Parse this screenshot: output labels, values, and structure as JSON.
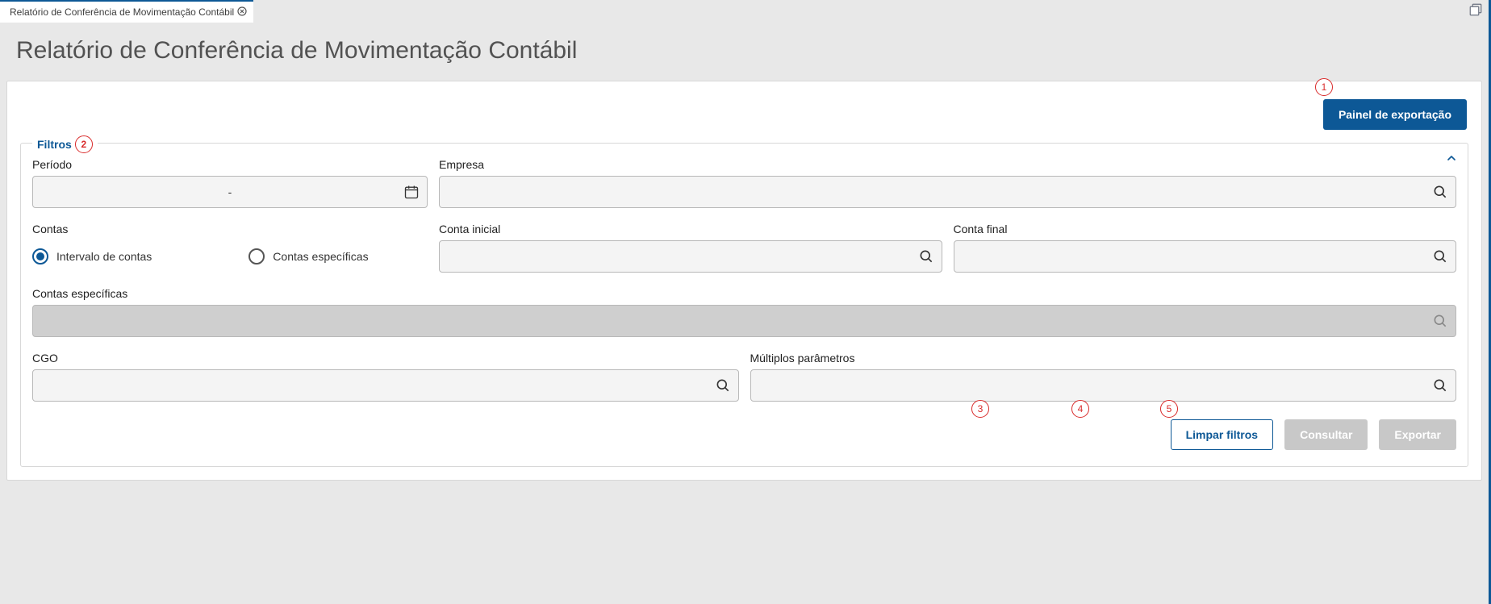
{
  "tab": {
    "title": "Relatório de Conferência de Movimentação Contábil"
  },
  "page": {
    "title": "Relatório de Conferência de Movimentação Contábil"
  },
  "buttons": {
    "export_panel": "Painel de exportação",
    "clear_filters": "Limpar filtros",
    "consult": "Consultar",
    "export": "Exportar"
  },
  "filters": {
    "legend": "Filtros",
    "periodo": {
      "label": "Período",
      "value": "-"
    },
    "empresa": {
      "label": "Empresa",
      "value": ""
    },
    "contas": {
      "label": "Contas",
      "options": {
        "intervalo": "Intervalo de contas",
        "especificas": "Contas específicas"
      },
      "selected": "intervalo"
    },
    "conta_inicial": {
      "label": "Conta inicial",
      "value": ""
    },
    "conta_final": {
      "label": "Conta final",
      "value": ""
    },
    "contas_especificas": {
      "label": "Contas específicas",
      "value": ""
    },
    "cgo": {
      "label": "CGO",
      "value": ""
    },
    "multiplos_parametros": {
      "label": "Múltiplos parâmetros",
      "value": ""
    }
  },
  "annotations": {
    "a1": "1",
    "a2": "2",
    "a3": "3",
    "a4": "4",
    "a5": "5"
  }
}
